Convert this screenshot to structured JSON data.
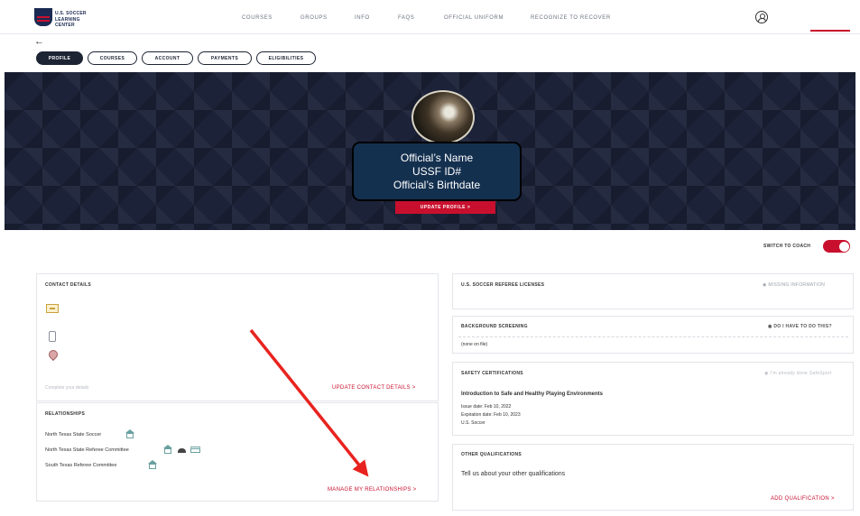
{
  "brand": {
    "line1": "U.S. SOCCER",
    "line2": "LEARNING CENTER"
  },
  "nav": {
    "links": [
      "COURSES",
      "GROUPS",
      "INFO",
      "FAQS",
      "OFFICIAL UNIFORM",
      "RECOGNIZE TO RECOVER"
    ]
  },
  "back": "←",
  "tabs": [
    "PROFILE",
    "COURSES",
    "ACCOUNT",
    "PAYMENTS",
    "ELIGIBILITIES"
  ],
  "hero": {
    "name": "Official’s Name",
    "id": "USSF ID#",
    "birthdate": "Official’s Birthdate",
    "update_profile": "UPDATE PROFILE  >"
  },
  "switch_to_coach": "SWITCH TO COACH",
  "contact": {
    "title": "CONTACT DETAILS",
    "complete_details": "Complete your details",
    "update": "UPDATE CONTACT DETAILS  >"
  },
  "relationships": {
    "title": "RELATIONSHIPS",
    "items": [
      "North Texas State Soccer",
      "North Texas State Referee Committee",
      "South Texas Referee Committee"
    ],
    "manage": "MANAGE MY RELATIONSHIPS  >"
  },
  "licenses": {
    "title": "U.S. SOCCER REFEREE LICENSES",
    "meta": "MISSING INFORMATION"
  },
  "background": {
    "title": "BACKGROUND SCREENING",
    "meta": "DO I HAVE TO DO THIS?",
    "status": "(none on file)"
  },
  "safety": {
    "title": "SAFETY CERTIFICATIONS",
    "meta": "I’m already done SafeSport",
    "course": "Introduction to Safe and Healthy Playing Environments",
    "issue": "Issue date: Feb 10, 2022",
    "expiration": "Expiration date: Feb 10, 2023",
    "provider": "U.S. Soccer"
  },
  "other": {
    "title": "OTHER QUALIFICATIONS",
    "prompt": "Tell us about your other qualifications",
    "add": "ADD QUALIFICATION  >"
  },
  "annotation_color": "#e8231f"
}
